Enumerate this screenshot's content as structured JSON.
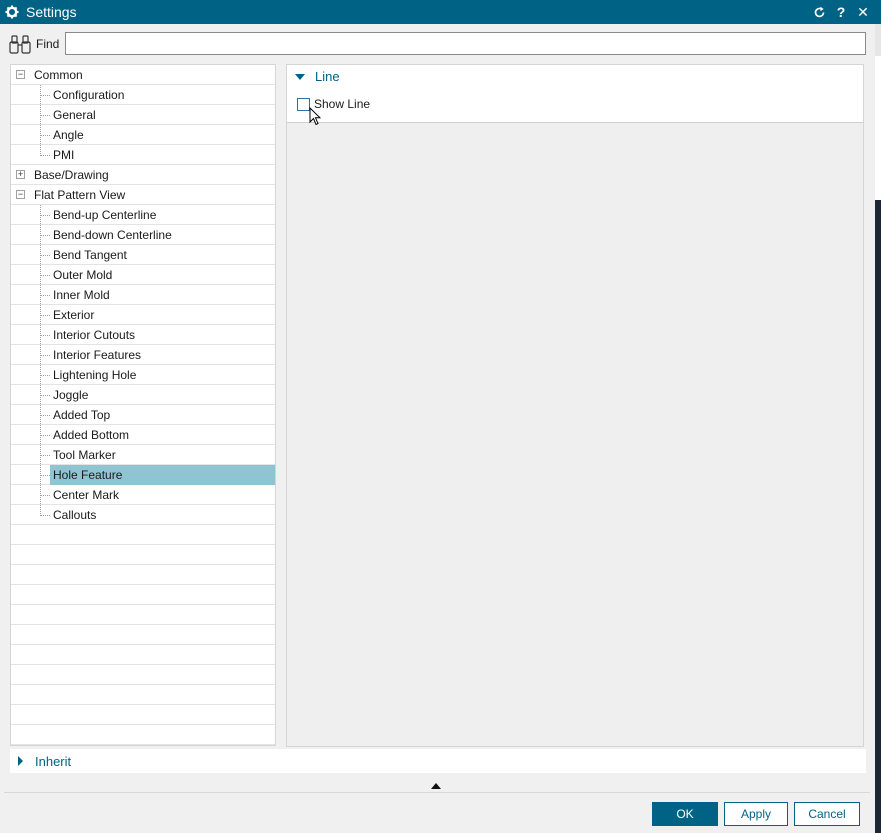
{
  "window": {
    "title": "Settings"
  },
  "titlebar_icons": [
    "reset-icon",
    "help-icon",
    "close-icon"
  ],
  "titlebar_glyphs": {
    "help": "?",
    "close": "✕"
  },
  "find": {
    "label": "Find",
    "value": ""
  },
  "tree": [
    {
      "label": "Common",
      "level": 0,
      "expander": "−",
      "key": "common"
    },
    {
      "label": "Configuration",
      "level": 1,
      "key": "configuration"
    },
    {
      "label": "General",
      "level": 1,
      "key": "general"
    },
    {
      "label": "Angle",
      "level": 1,
      "key": "angle"
    },
    {
      "label": "PMI",
      "level": 1,
      "key": "pmi"
    },
    {
      "label": "Base/Drawing",
      "level": 0,
      "expander": "+",
      "key": "base-drawing"
    },
    {
      "label": "Flat Pattern View",
      "level": 0,
      "expander": "−",
      "key": "flat-pattern-view"
    },
    {
      "label": "Bend-up Centerline",
      "level": 1,
      "key": "bend-up-centerline"
    },
    {
      "label": "Bend-down Centerline",
      "level": 1,
      "key": "bend-down-centerline"
    },
    {
      "label": "Bend Tangent",
      "level": 1,
      "key": "bend-tangent"
    },
    {
      "label": "Outer Mold",
      "level": 1,
      "key": "outer-mold"
    },
    {
      "label": "Inner Mold",
      "level": 1,
      "key": "inner-mold"
    },
    {
      "label": "Exterior",
      "level": 1,
      "key": "exterior"
    },
    {
      "label": "Interior Cutouts",
      "level": 1,
      "key": "interior-cutouts"
    },
    {
      "label": "Interior Features",
      "level": 1,
      "key": "interior-features"
    },
    {
      "label": "Lightening Hole",
      "level": 1,
      "key": "lightening-hole"
    },
    {
      "label": "Joggle",
      "level": 1,
      "key": "joggle"
    },
    {
      "label": "Added Top",
      "level": 1,
      "key": "added-top"
    },
    {
      "label": "Added Bottom",
      "level": 1,
      "key": "added-bottom"
    },
    {
      "label": "Tool Marker",
      "level": 1,
      "key": "tool-marker"
    },
    {
      "label": "Hole Feature",
      "level": 1,
      "key": "hole-feature",
      "selected": true
    },
    {
      "label": "Center Mark",
      "level": 1,
      "key": "center-mark"
    },
    {
      "label": "Callouts",
      "level": 1,
      "key": "callouts"
    }
  ],
  "panel": {
    "group_title": "Line",
    "show_line": {
      "label": "Show Line",
      "checked": false
    }
  },
  "inherit": {
    "label": "Inherit"
  },
  "buttons": {
    "ok": "OK",
    "apply": "Apply",
    "cancel": "Cancel"
  },
  "colors": {
    "accent": "#006385",
    "selection": "#8fc5d2"
  }
}
